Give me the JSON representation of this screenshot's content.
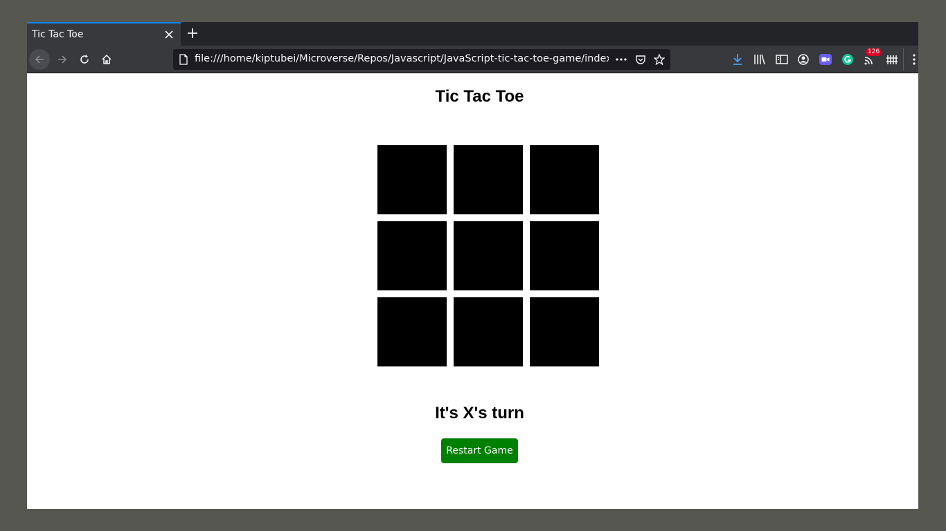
{
  "browser": {
    "tab_title": "Tic Tac Toe",
    "url": "file:///home/kiptubei/Microverse/Repos/Javascript/JavaScript-tic-tac-toe-game/index.html",
    "notification_badge": "126",
    "accent_color": "#0a84ff"
  },
  "page": {
    "title": "Tic Tac Toe",
    "status": "It's X's turn",
    "restart_label": "Restart Game",
    "button_color": "#008000",
    "cell_color": "#000000",
    "cells": [
      "",
      "",
      "",
      "",
      "",
      "",
      "",
      "",
      ""
    ]
  },
  "icons": {
    "toolbar": [
      "download-icon",
      "library-icon",
      "sidebar-icon",
      "account-icon",
      "video-icon",
      "grammarly-icon",
      "rss-icon",
      "extension-icon",
      "menu-icon"
    ]
  }
}
